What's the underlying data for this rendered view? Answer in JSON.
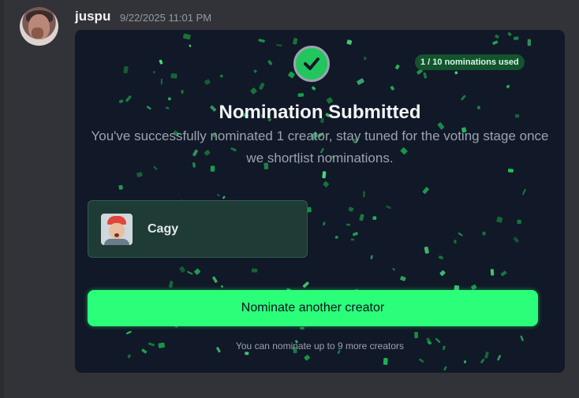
{
  "message": {
    "username": "juspu",
    "timestamp": "9/22/2025 11:01 PM"
  },
  "card": {
    "usage_badge": "1 / 10 nominations used",
    "title": "Nomination Submitted",
    "subtitle": "You've successfully nominated 1 creator, stay tuned for the voting stage once we shortlist nominations.",
    "nominee": {
      "name": "Cagy"
    },
    "button_label": "Nominate another creator",
    "footer_note": "You can nominate up to 9 more creators"
  },
  "colors": {
    "accent": "#2bff7a",
    "card_bg": "#111827",
    "confetti": "#22c55e"
  },
  "icons": {
    "status": "checkmark-icon"
  }
}
